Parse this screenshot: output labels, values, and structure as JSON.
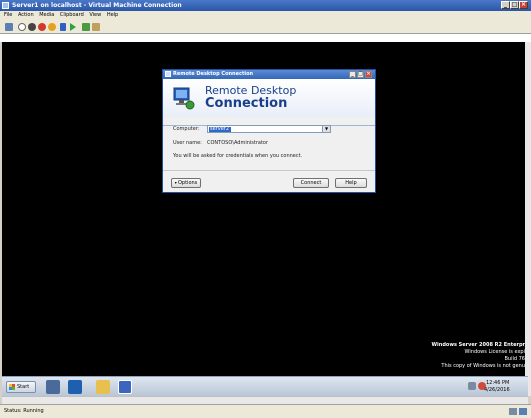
{
  "window": {
    "title": "Server1 on localhost - Virtual Machine Connection",
    "minimize": "_",
    "maximize": "□",
    "close": "×"
  },
  "menu": [
    "File",
    "Action",
    "Media",
    "Clipboard",
    "View",
    "Help"
  ],
  "toolbar_icons": [
    "ctrl-alt-del-icon",
    "start-icon",
    "turn-off-icon",
    "shutdown-icon",
    "save-icon",
    "pause-icon",
    "resume-icon",
    "snapshot-icon",
    "revert-icon"
  ],
  "dialog": {
    "title": "Remote Desktop Connection",
    "minimize": "_",
    "maximize": "□",
    "close": "×",
    "banner_line1": "Remote Desktop",
    "banner_line2": "Connection",
    "computer_label": "Computer:",
    "computer_value": "server2",
    "username_label": "User name:",
    "username_value": "CONTOSO\\Administrator",
    "credentials_note": "You will be asked for credentials when you connect.",
    "options_label": "Options",
    "connect_label": "Connect",
    "help_label": "Help"
  },
  "watermark": {
    "line1": "Windows Server 2008 R2 Enterpr",
    "line2": "Windows License is expi",
    "line3": "Build 76",
    "line4": "This copy of Windows is not genu"
  },
  "taskbar": {
    "start_label": "Start",
    "time": "12:46 PM",
    "date": "4/26/2016"
  },
  "status": {
    "text": "Status: Running"
  },
  "colors": {
    "title_blue": "#2a56a8",
    "banner_text": "#1a3f8a",
    "screen_bg": "#000000"
  }
}
